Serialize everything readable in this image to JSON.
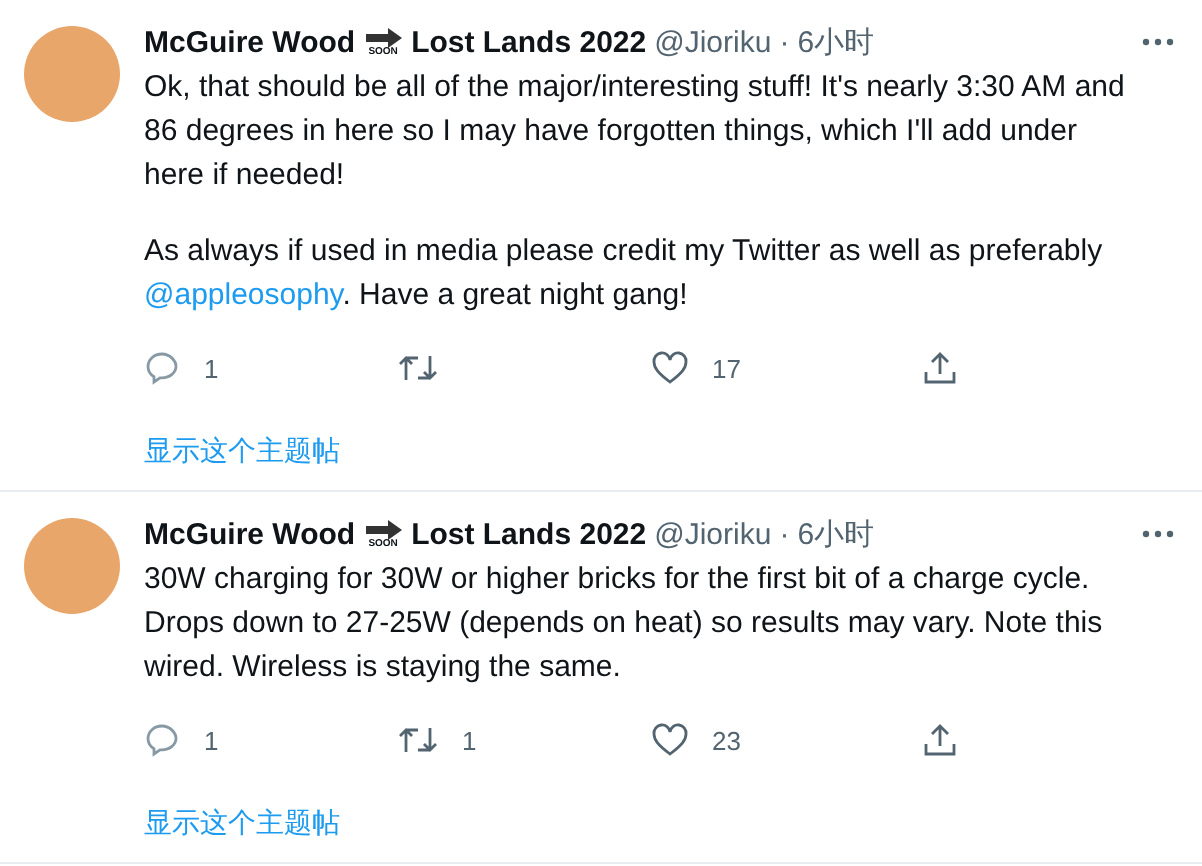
{
  "tweets": [
    {
      "name_before": "McGuire Wood",
      "emoji_label": "SOON",
      "name_after": "Lost Lands 2022",
      "handle": "@Jioriku",
      "separator": "·",
      "time": "6小时",
      "paragraphs": [
        [
          {
            "kind": "text",
            "text": "Ok, that should be all of the major/interesting stuff! It's nearly 3:30 AM and 86 degrees in here so I may have forgotten things, which I'll add under here if needed!"
          }
        ],
        [
          {
            "kind": "text",
            "text": "As always if used in media please credit my Twitter as well as preferably "
          },
          {
            "kind": "link",
            "text": "@appleosophy"
          },
          {
            "kind": "text",
            "text": ". Have a great night gang!"
          }
        ]
      ],
      "replies": "1",
      "likes": "17",
      "thread_link": "显示这个主题帖"
    },
    {
      "name_before": "McGuire Wood",
      "emoji_label": "SOON",
      "name_after": "Lost Lands 2022",
      "handle": "@Jioriku",
      "separator": "·",
      "time": "6小时",
      "paragraphs": [
        [
          {
            "kind": "text",
            "text": "30W charging for 30W or higher bricks for the first bit of a charge cycle. Drops down to 27-25W (depends on heat) so results may vary. Note this wired. Wireless is staying the same."
          }
        ]
      ],
      "replies": "1",
      "retweets": "1",
      "likes": "23",
      "thread_link": "显示这个主题帖"
    }
  ]
}
